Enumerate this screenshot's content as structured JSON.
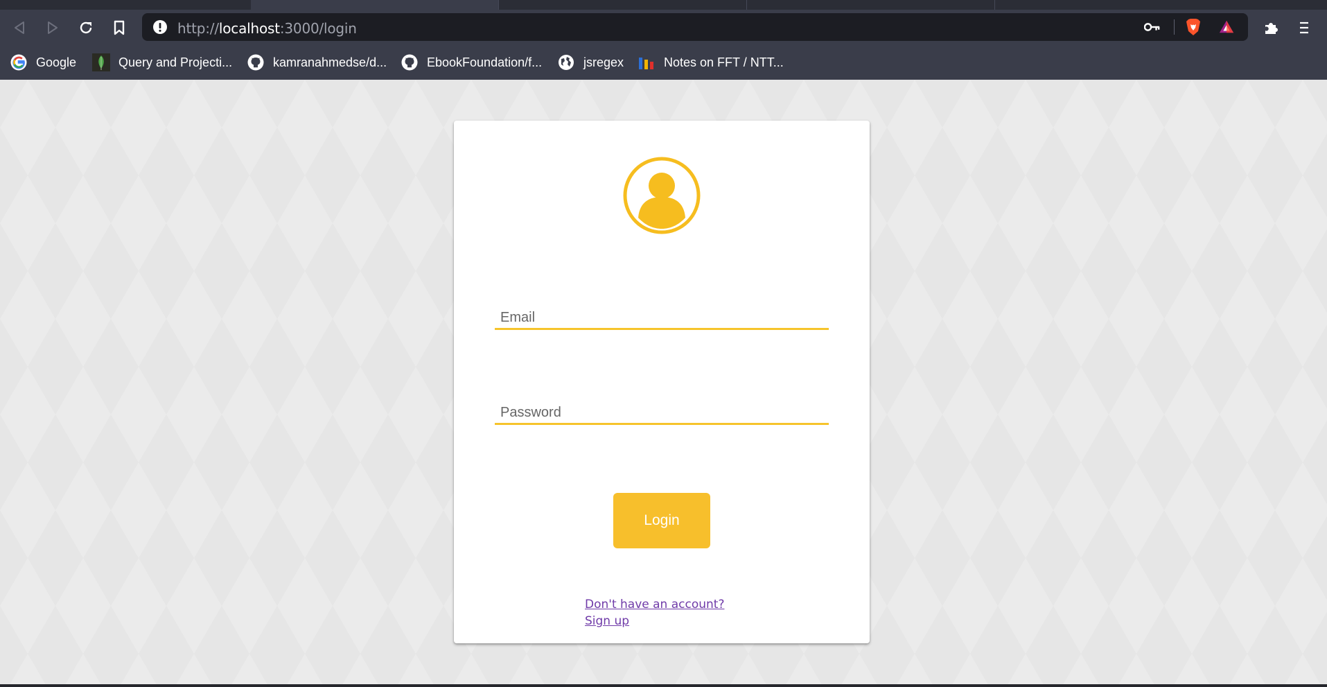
{
  "browser": {
    "url": {
      "scheme": "http://",
      "host": "localhost",
      "rest": ":3000/login"
    },
    "bookmarks": [
      {
        "label": "Google",
        "icon": "google-icon"
      },
      {
        "label": "Query and Projecti...",
        "icon": "mongodb-leaf-icon"
      },
      {
        "label": "kamranahmedse/d...",
        "icon": "github-icon"
      },
      {
        "label": "EbookFoundation/f...",
        "icon": "github-icon"
      },
      {
        "label": "jsregex",
        "icon": "globe-icon"
      },
      {
        "label": "Notes on FFT / NTT...",
        "icon": "bar-chart-icon"
      }
    ]
  },
  "login_form": {
    "avatar_icon": "user-avatar-icon",
    "email_placeholder": "Email",
    "password_placeholder": "Password",
    "login_label": "Login",
    "signup_prompt": "Don't have an account?",
    "signup_link": "Sign up"
  },
  "colors": {
    "accent": "#f7bf2c",
    "underline": "#f6c42b",
    "link": "#6f3aa8",
    "chrome_bg": "#3a3d4a",
    "urlbar_bg": "#1c1d23"
  }
}
